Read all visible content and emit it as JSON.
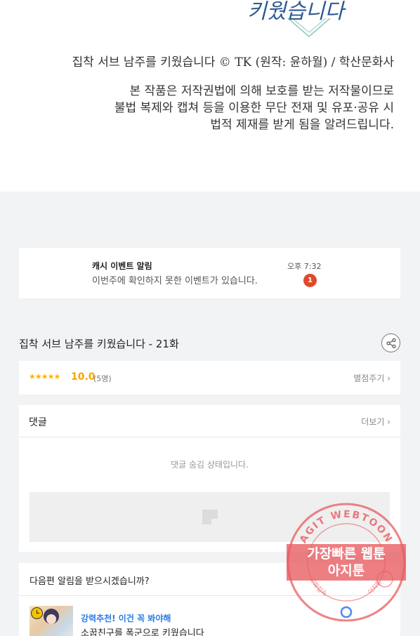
{
  "viewer": {
    "logo_text": "키웠습니다",
    "copyright": "집착 서브 남주를 키웠습니다 © TK (원작: 윤하월) / 학산문화사",
    "notice_lines": [
      "본 작품은 저작권법에 의해 보호를 받는 저작물이므로",
      "불법 복제와 캡쳐 등을 이용한 무단 전재 및 유포·공유 시",
      "법적 제재를 받게 됨을 알려드립니다."
    ]
  },
  "cash_event": {
    "title": "캐시 이벤트 알림",
    "time": "오후 7:32",
    "message": "이번주에 확인하지 못한 이벤트가 있습니다.",
    "badge_count": "1",
    "badge_color": "#e04a2c"
  },
  "episode": {
    "title": "집착 서브 남주를 키웠습니다 - 21화",
    "share_icon": "share-icon"
  },
  "rating": {
    "stars": "★★★★★",
    "score": "10.0",
    "count": "(5명)",
    "rate_button": "별점주기 ›",
    "star_color": "#ffb400"
  },
  "comments": {
    "title": "댓글",
    "more_button": "더보기 ›",
    "hidden_message": "댓글 숨김 상태입니다."
  },
  "next_alert": {
    "question": "다음편 알림을 받으시겠습니까?"
  },
  "recommend": {
    "tag": "강력추천! 이건 꼭 봐야해",
    "title": "소꿉친구를 폭군으로 키웠습니다",
    "tag_color": "#2a7be4"
  },
  "watermark": {
    "ring_text": "AGIT WEBTOON",
    "line1": "가장빠른 웹툰",
    "line2": "아지툰",
    "bottom_left": "고화질속",
    "bottom_right": "아지툰",
    "color": "#e85a5f"
  }
}
